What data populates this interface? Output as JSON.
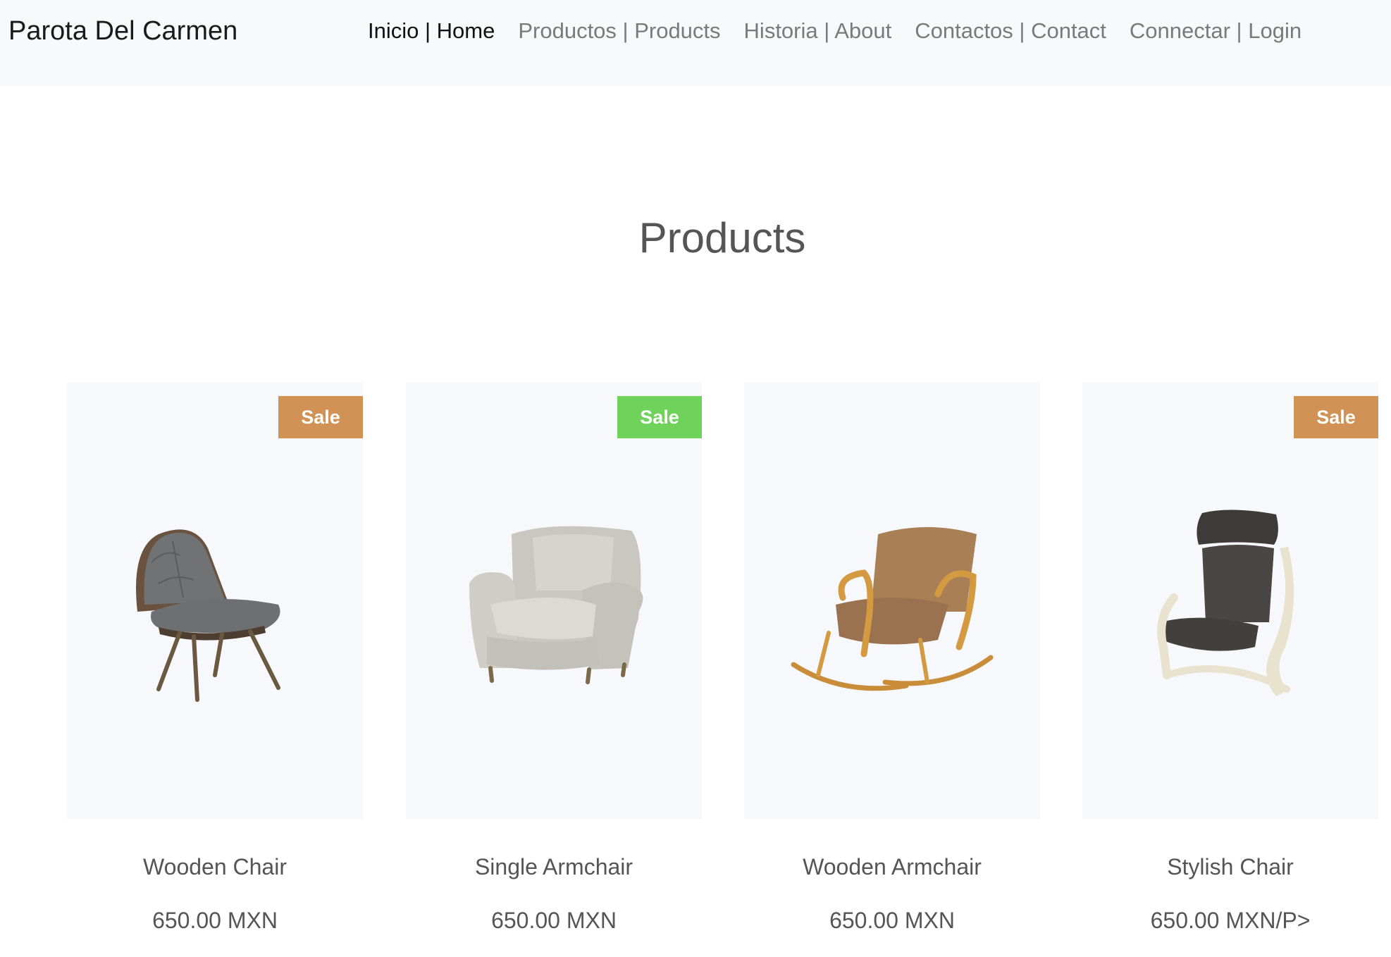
{
  "nav": {
    "brand": "Parota Del Carmen",
    "links": [
      {
        "label": "Inicio | Home",
        "active": true
      },
      {
        "label": "Productos | Products",
        "active": false
      },
      {
        "label": "Historia | About",
        "active": false
      },
      {
        "label": "Contactos | Contact",
        "active": false
      },
      {
        "label": "Connectar | Login",
        "active": false
      }
    ]
  },
  "section": {
    "title": "Products"
  },
  "products": [
    {
      "name": "Wooden Chair",
      "price": "650.00 MXN",
      "badge": "Sale",
      "badge_color": "#d09355",
      "image_icon": "lounge-chair-icon"
    },
    {
      "name": "Single Armchair",
      "price": "650.00 MXN",
      "badge": "Sale",
      "badge_color": "#6fd35b",
      "image_icon": "armchair-icon"
    },
    {
      "name": "Wooden Armchair",
      "price": "650.00 MXN",
      "badge": "",
      "badge_color": "",
      "image_icon": "rocking-chair-icon"
    },
    {
      "name": "Stylish Chair",
      "price": "650.00 MXN/P>",
      "badge": "Sale",
      "badge_color": "#d09355",
      "image_icon": "stylish-chair-icon"
    }
  ]
}
